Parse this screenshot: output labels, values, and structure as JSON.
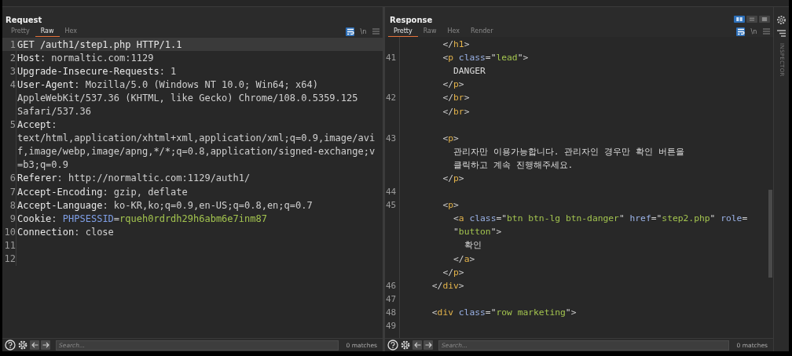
{
  "request": {
    "title": "Request",
    "tabs": [
      {
        "label": "Pretty",
        "selected": false
      },
      {
        "label": "Raw",
        "selected": true
      },
      {
        "label": "Hex",
        "selected": false
      }
    ],
    "toolbar": {
      "wrap_on": true,
      "newline_label": "\\n",
      "newline_on": false
    },
    "lines": [
      {
        "number": "1",
        "current": true,
        "segments": [
          {
            "kind": "name",
            "text": "GET /auth1/step1.php HTTP/1.1"
          }
        ]
      },
      {
        "number": "2",
        "current": false,
        "segments": [
          {
            "kind": "name",
            "text": "Host"
          },
          {
            "kind": "value",
            "text": ": normaltic.com:1129"
          }
        ]
      },
      {
        "number": "3",
        "current": false,
        "segments": [
          {
            "kind": "name",
            "text": "Upgrade-Insecure-Requests"
          },
          {
            "kind": "value",
            "text": ": 1"
          }
        ]
      },
      {
        "number": "4",
        "current": false,
        "segments": [
          {
            "kind": "name",
            "text": "User-Agent"
          },
          {
            "kind": "value",
            "text": ": Mozilla/5.0 (Windows NT 10.0; Win64; x64)"
          }
        ]
      },
      {
        "current": false,
        "segments": [
          {
            "kind": "value",
            "text": "AppleWebKit/537.36 (KHTML, like Gecko) Chrome/108.0.5359.125"
          }
        ]
      },
      {
        "current": false,
        "segments": [
          {
            "kind": "value",
            "text": "Safari/537.36"
          }
        ]
      },
      {
        "number": "5",
        "current": false,
        "segments": [
          {
            "kind": "name",
            "text": "Accept"
          },
          {
            "kind": "value",
            "text": ":"
          }
        ]
      },
      {
        "current": false,
        "segments": [
          {
            "kind": "value",
            "text": "text/html,application/xhtml+xml,application/xml;q=0.9,image/avi"
          }
        ]
      },
      {
        "current": false,
        "segments": [
          {
            "kind": "value",
            "text": "f,image/webp,image/apng,*/*;q=0.8,application/signed-exchange;v"
          }
        ]
      },
      {
        "current": false,
        "segments": [
          {
            "kind": "value",
            "text": "=b3;q=0.9"
          }
        ]
      },
      {
        "number": "6",
        "current": false,
        "segments": [
          {
            "kind": "name",
            "text": "Referer"
          },
          {
            "kind": "value",
            "text": ": http://normaltic.com:1129/auth1/"
          }
        ]
      },
      {
        "number": "7",
        "current": false,
        "segments": [
          {
            "kind": "name",
            "text": "Accept-Encoding"
          },
          {
            "kind": "value",
            "text": ": gzip, deflate"
          }
        ]
      },
      {
        "number": "8",
        "current": false,
        "segments": [
          {
            "kind": "name",
            "text": "Accept-Language"
          },
          {
            "kind": "value",
            "text": ": ko-KR,ko;q=0.9,en-US;q=0.8,en;q=0.7"
          }
        ]
      },
      {
        "number": "9",
        "current": false,
        "segments": [
          {
            "kind": "name",
            "text": "Cookie"
          },
          {
            "kind": "value",
            "text": ": "
          },
          {
            "kind": "param-name",
            "text": "PHPSESSID"
          },
          {
            "kind": "value",
            "text": "="
          },
          {
            "kind": "param-value",
            "text": "rqueh0rdrdh29h6abm6e7inm87"
          }
        ]
      },
      {
        "number": "10",
        "current": false,
        "segments": [
          {
            "kind": "name",
            "text": "Connection"
          },
          {
            "kind": "value",
            "text": ": close"
          }
        ]
      },
      {
        "number": "11",
        "current": false
      },
      {
        "number": "12",
        "current": false
      }
    ],
    "search": {
      "placeholder": "Search..."
    },
    "matches": "0 matches"
  },
  "response": {
    "title": "Response",
    "tabs": [
      {
        "label": "Pretty",
        "selected": true
      },
      {
        "label": "Raw",
        "selected": false
      },
      {
        "label": "Hex",
        "selected": false
      },
      {
        "label": "Render",
        "selected": false
      }
    ],
    "layout_options": [
      {
        "kind": "columns",
        "selected": true
      },
      {
        "kind": "rows",
        "selected": false
      },
      {
        "kind": "single",
        "selected": false
      }
    ],
    "toolbar": {
      "wrap_on": true,
      "newline_label": "\\n",
      "newline_on": false
    },
    "lines": [
      {
        "current": false,
        "segments": [
          {
            "kind": "punct",
            "text": "        </"
          },
          {
            "kind": "tag",
            "text": "h1"
          },
          {
            "kind": "punct",
            "text": ">"
          }
        ]
      },
      {
        "number": "41",
        "current": false,
        "segments": [
          {
            "kind": "punct",
            "text": "        <"
          },
          {
            "kind": "tag",
            "text": "p"
          },
          {
            "kind": "attr",
            "text": " class"
          },
          {
            "kind": "punct",
            "text": "=\""
          },
          {
            "kind": "str",
            "text": "lead"
          },
          {
            "kind": "punct",
            "text": "\">"
          }
        ]
      },
      {
        "current": false,
        "segments": [
          {
            "kind": "text",
            "text": "          DANGER"
          }
        ]
      },
      {
        "current": false,
        "segments": [
          {
            "kind": "punct",
            "text": "        </"
          },
          {
            "kind": "tag",
            "text": "p"
          },
          {
            "kind": "punct",
            "text": ">"
          }
        ]
      },
      {
        "number": "42",
        "current": false,
        "segments": [
          {
            "kind": "punct",
            "text": "        </"
          },
          {
            "kind": "tag",
            "text": "br"
          },
          {
            "kind": "punct",
            "text": ">"
          }
        ]
      },
      {
        "current": false,
        "segments": [
          {
            "kind": "punct",
            "text": "        </"
          },
          {
            "kind": "tag",
            "text": "br"
          },
          {
            "kind": "punct",
            "text": ">"
          }
        ]
      },
      {
        "number": "43",
        "gap_before": true,
        "current": false,
        "segments": [
          {
            "kind": "punct",
            "text": "        <"
          },
          {
            "kind": "tag",
            "text": "p"
          },
          {
            "kind": "punct",
            "text": ">"
          }
        ]
      },
      {
        "current": false,
        "segments": [
          {
            "kind": "text",
            "text": "          관리자만 이용가능합니다. 관리자인 경우만 확인 버튼을"
          }
        ]
      },
      {
        "current": false,
        "segments": [
          {
            "kind": "text",
            "text": "          클릭하고 계속 진행해주세요."
          }
        ]
      },
      {
        "current": false,
        "segments": [
          {
            "kind": "punct",
            "text": "        </"
          },
          {
            "kind": "tag",
            "text": "p"
          },
          {
            "kind": "punct",
            "text": ">"
          }
        ]
      },
      {
        "number": "44"
      },
      {
        "number": "45",
        "current": false,
        "segments": [
          {
            "kind": "punct",
            "text": "        <"
          },
          {
            "kind": "tag",
            "text": "p"
          },
          {
            "kind": "punct",
            "text": ">"
          }
        ]
      },
      {
        "current": false,
        "segments": [
          {
            "kind": "punct",
            "text": "          <"
          },
          {
            "kind": "tag",
            "text": "a"
          },
          {
            "kind": "attr",
            "text": " class"
          },
          {
            "kind": "punct",
            "text": "=\""
          },
          {
            "kind": "str",
            "text": "btn btn-lg btn-danger"
          },
          {
            "kind": "punct",
            "text": "\" "
          },
          {
            "kind": "attr",
            "text": "href"
          },
          {
            "kind": "punct",
            "text": "=\""
          },
          {
            "kind": "str",
            "text": "step2.php"
          },
          {
            "kind": "punct",
            "text": "\" "
          },
          {
            "kind": "attr",
            "text": "role"
          },
          {
            "kind": "punct",
            "text": "="
          }
        ]
      },
      {
        "current": false,
        "segments": [
          {
            "kind": "punct",
            "text": "          \""
          },
          {
            "kind": "str",
            "text": "button"
          },
          {
            "kind": "punct",
            "text": "\">"
          }
        ]
      },
      {
        "current": false,
        "segments": [
          {
            "kind": "text",
            "text": "            확인"
          }
        ]
      },
      {
        "current": false,
        "segments": [
          {
            "kind": "punct",
            "text": "          </"
          },
          {
            "kind": "tag",
            "text": "a"
          },
          {
            "kind": "punct",
            "text": ">"
          }
        ]
      },
      {
        "current": false,
        "segments": [
          {
            "kind": "punct",
            "text": "        </"
          },
          {
            "kind": "tag",
            "text": "p"
          },
          {
            "kind": "punct",
            "text": ">"
          }
        ]
      },
      {
        "number": "46",
        "current": false,
        "segments": [
          {
            "kind": "punct",
            "text": "      </"
          },
          {
            "kind": "tag",
            "text": "div"
          },
          {
            "kind": "punct",
            "text": ">"
          }
        ]
      },
      {
        "number": "47"
      },
      {
        "number": "48",
        "current": false,
        "segments": [
          {
            "kind": "punct",
            "text": "      <"
          },
          {
            "kind": "tag",
            "text": "div"
          },
          {
            "kind": "attr",
            "text": " class"
          },
          {
            "kind": "punct",
            "text": "=\""
          },
          {
            "kind": "str",
            "text": "row marketing"
          },
          {
            "kind": "punct",
            "text": "\">"
          }
        ]
      },
      {
        "number": "49"
      }
    ],
    "search": {
      "placeholder": "Search..."
    },
    "matches": "0 matches"
  },
  "inspector": {
    "label": "INSPECTOR"
  }
}
